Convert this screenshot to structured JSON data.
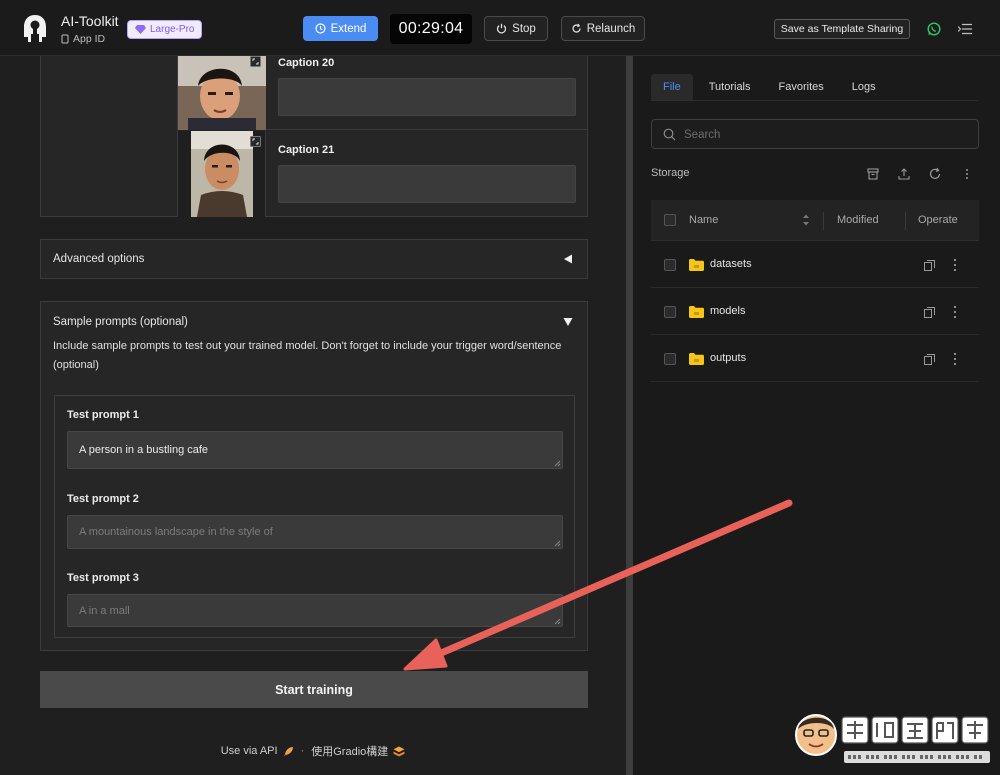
{
  "app": {
    "title": "AI-Toolkit",
    "app_id_label": "App ID",
    "plan_badge": "Large-Pro",
    "accent": "#4a8cf1"
  },
  "toolbar": {
    "extend_label": "Extend",
    "timer": "00:29:04",
    "stop_label": "Stop",
    "relaunch_label": "Relaunch",
    "template_label": "Save as Template Sharing"
  },
  "captions": [
    {
      "label": "Caption 20",
      "value": ""
    },
    {
      "label": "Caption 21",
      "value": ""
    }
  ],
  "advanced": {
    "title": "Advanced options"
  },
  "sample": {
    "title": "Sample prompts (optional)",
    "description": "Include sample prompts to test out your trained model. Don't forget to include your trigger word/sentence (optional)",
    "prompts": [
      {
        "label": "Test prompt 1",
        "value": "A person in a bustling cafe",
        "placeholder": ""
      },
      {
        "label": "Test prompt 2",
        "value": "",
        "placeholder": "A mountainous landscape in the style of"
      },
      {
        "label": "Test prompt 3",
        "value": "",
        "placeholder": "A  in a mall"
      }
    ]
  },
  "start_button": "Start training",
  "footer": {
    "api_link": "Use via API",
    "separator": "·",
    "built_with": "使用Gradio構建"
  },
  "files": {
    "tabs": [
      {
        "label": "File",
        "active": true
      },
      {
        "label": "Tutorials",
        "active": false
      },
      {
        "label": "Favorites",
        "active": false
      },
      {
        "label": "Logs",
        "active": false
      }
    ],
    "search_placeholder": "Search",
    "storage_label": "Storage",
    "columns": {
      "name": "Name",
      "modified": "Modified",
      "operate": "Operate"
    },
    "rows": [
      {
        "name": "datasets"
      },
      {
        "name": "models"
      },
      {
        "name": "outputs"
      }
    ],
    "folder_color": "#f5c518"
  },
  "watermark": {
    "title": "電腦王阿達",
    "url": "http://www.kocpc.com.tw"
  },
  "annotation_color": "#e8625a"
}
